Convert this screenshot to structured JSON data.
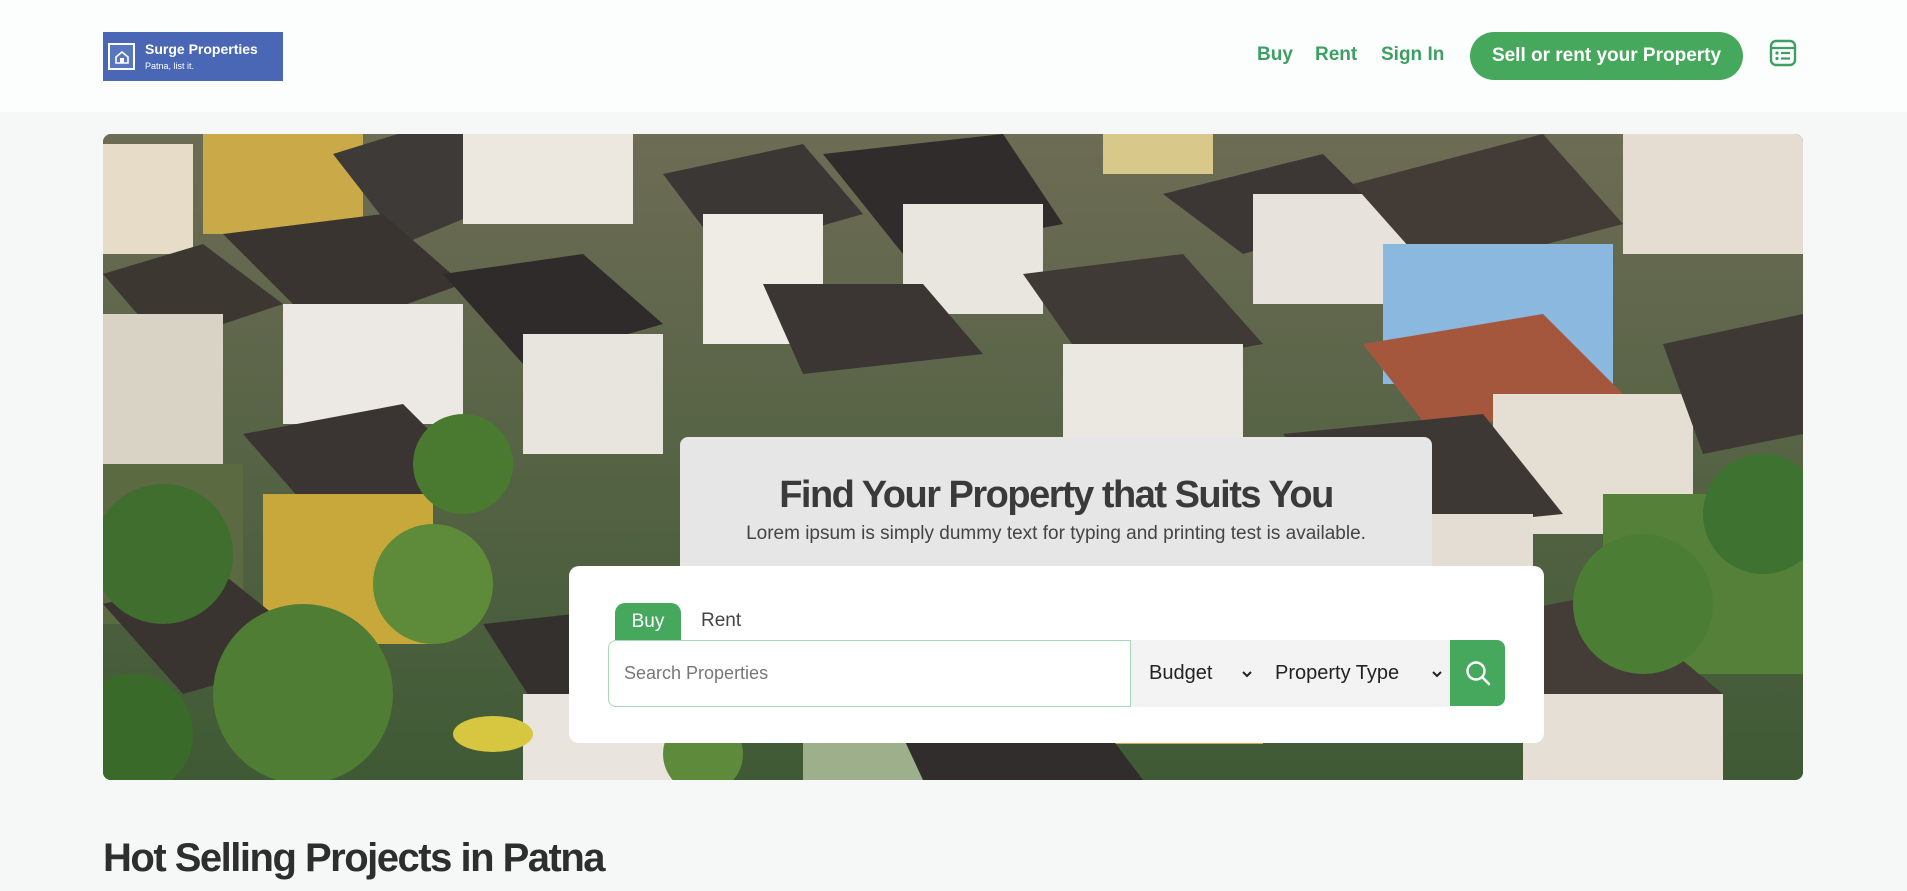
{
  "brand": {
    "name": "Surge Properties",
    "tagline": "Patna, list it."
  },
  "nav": {
    "buy": "Buy",
    "rent": "Rent",
    "sign_in": "Sign In",
    "cta": "Sell or rent your Property",
    "menu_icon": "list-icon"
  },
  "hero": {
    "title": "Find Your Property that Suits You",
    "subtitle": "Lorem ipsum is simply dummy text for typing and printing test is available.",
    "tabs": {
      "buy": "Buy",
      "rent": "Rent",
      "active": "Buy"
    },
    "search": {
      "placeholder": "Search Properties",
      "value": ""
    },
    "budget": {
      "label": "Budget"
    },
    "property_type": {
      "label": "Property Type"
    },
    "search_icon": "search-icon"
  },
  "sections": {
    "hot_selling_title": "Hot Selling Projects in Patna"
  },
  "colors": {
    "brand_blue": "#4a67b5",
    "accent_green": "#46a85d",
    "nav_green": "#3e9f62"
  }
}
